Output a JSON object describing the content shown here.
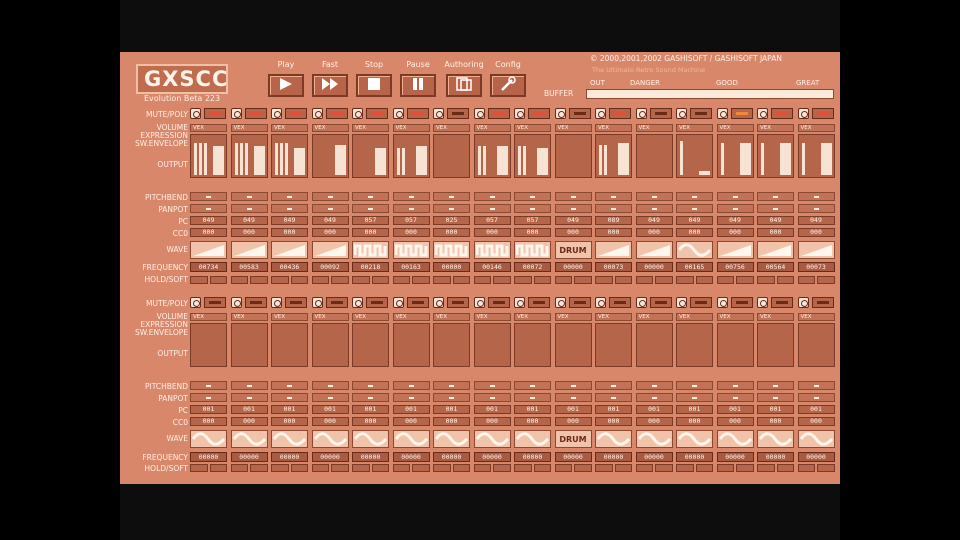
{
  "app": {
    "logo": "GXSCC",
    "logo_sub": "Evolution Beta 223"
  },
  "header": {
    "copyright": "© 2000,2001,2002 GASHISOFT / GASHISOFT JAPAN",
    "subtitle": "The Ultimate Retro Sound Machine"
  },
  "toolbar": [
    {
      "id": "play",
      "label": "Play",
      "icon": "play-icon"
    },
    {
      "id": "fast",
      "label": "Fast",
      "icon": "fast-forward-icon"
    },
    {
      "id": "stop",
      "label": "Stop",
      "icon": "stop-icon"
    },
    {
      "id": "pause",
      "label": "Pause",
      "icon": "pause-icon"
    },
    {
      "id": "authoring",
      "label": "Authoring",
      "icon": "authoring-icon"
    },
    {
      "id": "config",
      "label": "Config",
      "icon": "config-icon"
    }
  ],
  "buffer": {
    "label": "BUFFER",
    "scale": [
      "OUT",
      "DANGER",
      "GOOD",
      "GREAT"
    ],
    "level": 1.0
  },
  "labels": {
    "mute_poly": "MUTE/POLY",
    "volume": "VOLUME",
    "expression": "EXPRESSION",
    "sw_envelope": "SW.ENVELOPE",
    "output": "OUTPUT",
    "pitchbend": "PITCHBEND",
    "panpot": "PANPOT",
    "pc": "PC",
    "cc0": "CC0",
    "wave": "WAVE",
    "frequency": "FREQUENCY",
    "hold_soft": "HOLD/SOFT"
  },
  "vol_label": "VEX",
  "top_channels": [
    {
      "pc": "049",
      "cc0": "000",
      "freq": "00734",
      "wave": "ramp",
      "poly": "#e0503a",
      "out": [
        0.85,
        0.85,
        0.85,
        0.75
      ]
    },
    {
      "pc": "049",
      "cc0": "000",
      "freq": "00583",
      "wave": "ramp",
      "poly": "#e0503a",
      "out": [
        0.85,
        0.85,
        0.85,
        0.75
      ]
    },
    {
      "pc": "049",
      "cc0": "000",
      "freq": "00436",
      "wave": "ramp",
      "poly": "#e0503a",
      "out": [
        0.85,
        0.85,
        0.85,
        0.7
      ]
    },
    {
      "pc": "049",
      "cc0": "000",
      "freq": "00092",
      "wave": "ramp",
      "poly": "#e0503a",
      "out": [
        0,
        0,
        0,
        0.8
      ]
    },
    {
      "pc": "057",
      "cc0": "000",
      "freq": "00218",
      "wave": "pulse",
      "poly": "#e0503a",
      "out": [
        0,
        0,
        0,
        0.7
      ]
    },
    {
      "pc": "057",
      "cc0": "000",
      "freq": "00163",
      "wave": "pulse",
      "poly": "#e0503a",
      "out": [
        0.7,
        0.7,
        0,
        0.75
      ]
    },
    {
      "pc": "025",
      "cc0": "000",
      "freq": "00000",
      "wave": "pulse",
      "poly": "#6a2a18",
      "out": [
        0,
        0,
        0,
        0
      ]
    },
    {
      "pc": "057",
      "cc0": "000",
      "freq": "00146",
      "wave": "pulse",
      "poly": "#e0503a",
      "out": [
        0.75,
        0.75,
        0,
        0.75
      ]
    },
    {
      "pc": "057",
      "cc0": "000",
      "freq": "00072",
      "wave": "pulse",
      "poly": "#e0503a",
      "out": [
        0.75,
        0.75,
        0,
        0.7
      ]
    },
    {
      "pc": "049",
      "cc0": "000",
      "freq": "00000",
      "wave": "drum",
      "poly": "#6a2a18",
      "out": [
        0,
        0,
        0,
        0
      ]
    },
    {
      "pc": "089",
      "cc0": "000",
      "freq": "00073",
      "wave": "ramp",
      "poly": "#e0503a",
      "out": [
        0.8,
        0.8,
        0,
        0.85
      ]
    },
    {
      "pc": "049",
      "cc0": "000",
      "freq": "00000",
      "wave": "ramp",
      "poly": "#6a2a18",
      "out": [
        0,
        0,
        0,
        0
      ]
    },
    {
      "pc": "049",
      "cc0": "000",
      "freq": "00165",
      "wave": "sine",
      "poly": "#6a2a18",
      "out": [
        0.9,
        0,
        0,
        0.1
      ]
    },
    {
      "pc": "049",
      "cc0": "000",
      "freq": "00756",
      "wave": "ramp",
      "poly": "#f08a3a",
      "out": [
        0.85,
        0,
        0,
        0.85
      ]
    },
    {
      "pc": "049",
      "cc0": "000",
      "freq": "00564",
      "wave": "ramp",
      "poly": "#e0503a",
      "out": [
        0.85,
        0,
        0,
        0.85
      ]
    },
    {
      "pc": "049",
      "cc0": "000",
      "freq": "00073",
      "wave": "ramp",
      "poly": "#e0503a",
      "out": [
        0.85,
        0,
        0,
        0.85
      ]
    }
  ],
  "bottom_channels": [
    {
      "pc": "001",
      "cc0": "000",
      "freq": "00000",
      "wave": "sine"
    },
    {
      "pc": "001",
      "cc0": "000",
      "freq": "00000",
      "wave": "sine"
    },
    {
      "pc": "001",
      "cc0": "000",
      "freq": "00000",
      "wave": "sine"
    },
    {
      "pc": "001",
      "cc0": "000",
      "freq": "00000",
      "wave": "sine"
    },
    {
      "pc": "001",
      "cc0": "000",
      "freq": "00000",
      "wave": "sine"
    },
    {
      "pc": "001",
      "cc0": "000",
      "freq": "00000",
      "wave": "sine"
    },
    {
      "pc": "001",
      "cc0": "000",
      "freq": "00000",
      "wave": "sine"
    },
    {
      "pc": "001",
      "cc0": "000",
      "freq": "00000",
      "wave": "sine"
    },
    {
      "pc": "001",
      "cc0": "000",
      "freq": "00000",
      "wave": "sine"
    },
    {
      "pc": "001",
      "cc0": "000",
      "freq": "00000",
      "wave": "drum"
    },
    {
      "pc": "001",
      "cc0": "000",
      "freq": "00000",
      "wave": "sine"
    },
    {
      "pc": "001",
      "cc0": "000",
      "freq": "00000",
      "wave": "sine"
    },
    {
      "pc": "001",
      "cc0": "000",
      "freq": "00000",
      "wave": "sine"
    },
    {
      "pc": "001",
      "cc0": "000",
      "freq": "00000",
      "wave": "sine"
    },
    {
      "pc": "001",
      "cc0": "000",
      "freq": "00000",
      "wave": "sine"
    },
    {
      "pc": "001",
      "cc0": "000",
      "freq": "00000",
      "wave": "sine"
    }
  ],
  "drum_label": "DRUM"
}
